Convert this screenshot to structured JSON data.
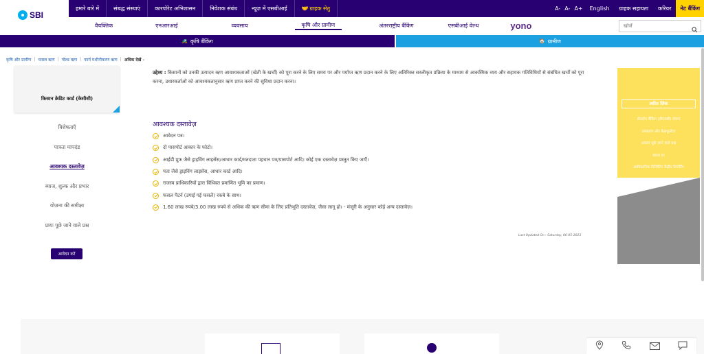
{
  "brand": {
    "logo_text": "SBI"
  },
  "topnav": [
    {
      "label": "हमारे बारे में"
    },
    {
      "label": "संबद्ध संस्थाएं"
    },
    {
      "label": "कारपोरेट अभिशासन"
    },
    {
      "label": "निवेशक संबंध"
    },
    {
      "label": "न्यूज़ में एसबीआई"
    },
    {
      "label": "ग्राहक सेतु"
    }
  ],
  "topright": {
    "font_small": "A-",
    "font_mid": "A-",
    "font_large": "A+",
    "language": "English",
    "customer_care": "ग्राहक सहायता",
    "career": "करियर",
    "net_banking": "नेट बैंकिंग"
  },
  "secnav": [
    {
      "label": "वैयक्तिक"
    },
    {
      "label": "एनआरआई"
    },
    {
      "label": "व्यवसाय"
    },
    {
      "label": "कृषि और ग्रामीण"
    },
    {
      "label": "अंतरराष्ट्रीय बैंकिंग"
    },
    {
      "label": "एसबीआई वेल्थ"
    },
    {
      "label": "yono"
    }
  ],
  "search": {
    "placeholder": "खोजें"
  },
  "bands": {
    "left": "कृषि बैंकिंग",
    "right": "ग्रामीण"
  },
  "breadcrumb": {
    "items": [
      "कृषि और ग्रामीण",
      "फसल ऋण",
      "गोल्ड ऋण",
      "फार्म मशीनीकरण ऋण"
    ],
    "current": "अधिक देखें"
  },
  "card": {
    "label": "किसान क्रेडिट कार्ड (केसीसी)"
  },
  "sidenav": [
    {
      "label": "विशेषताएँ"
    },
    {
      "label": "पात्रता मापदंड"
    },
    {
      "label": "आवश्यक दस्तावेज़"
    },
    {
      "label": "ब्याज, शुल्क और प्रभार"
    },
    {
      "label": "योजना की समीक्षा"
    },
    {
      "label": "प्रायः पूछे जाने वाले प्रश्न"
    }
  ],
  "apply_label": "आवेदन करें",
  "objective": {
    "label": "उद्देश्य :",
    "text": "किसानों को उनकी उत्पादन ऋण आवश्यकताओं (खेती के खर्चों) को पूरा करने के लिए समय पर और पर्याप्त ऋण प्रदान करने के लिए अतिरिक्त सरलीकृत प्रक्रिया के माध्यम से आकस्मिक व्यय और सहायक गतिविधियों से संबंधित खर्चों को पूरा करना, उधारकर्ताओं को आवश्यकतानुसार ऋण प्राप्त करने की सुविधा प्रदान करना।"
  },
  "documents": {
    "heading": "आवश्यक दस्तावेज़",
    "items": [
      "आवेदन पत्र।",
      "दो पासपोर्ट आकार के फोटो।",
      "आईडी प्रूफ जैसे ड्राइविंग लाइसेंस/आधार कार्ड/मतदाता पहचान पत्र/पासपोर्ट आदि। कोई एक दस्तावेज़ प्रस्तुत किए जाएँ।",
      "पता जैसे ड्राइविंग लाइसेंस, आधार कार्ड आदि।",
      "राजस्व प्राधिकारियों द्वारा विधिवत प्रमाणित भूमि का प्रमाण।",
      "फसल पैटर्न (उगाई गई फसलें) रकबे के साथ।",
      "1.60 लाख रुपये/3.00 लाख रुपये से अधिक की ऋण सीमा के लिए प्रतिभूति दस्तावेज़, जैसा लागू हो। - मंजूरी के अनुसार कोई अन्य दस्तावेज़।"
    ]
  },
  "last_updated": "Last Updated On : Saturday, 06-05-2023",
  "quick_links": {
    "heading": "त्वरित लिंक",
    "items": [
      "डोरस्टेप बैंकिंग (डीएसबी) सेवाएं",
      "उपकरण और कैलकुलेटर",
      "अक्सर पूछे जाने वाले प्रश्न",
      "ब्याज दर",
      "आधिकारिक विजिटिंग केंद्रीय रिपोर्टिंग"
    ]
  },
  "colors": {
    "brand_purple": "#280071",
    "brand_blue": "#1ba1e2",
    "accent_yellow": "#ffd200",
    "panel_yellow": "#fde05c"
  },
  "icons": {
    "location": "location-icon",
    "phone": "phone-icon",
    "mail": "mail-icon",
    "chat": "chat-icon",
    "search": "search-icon"
  }
}
